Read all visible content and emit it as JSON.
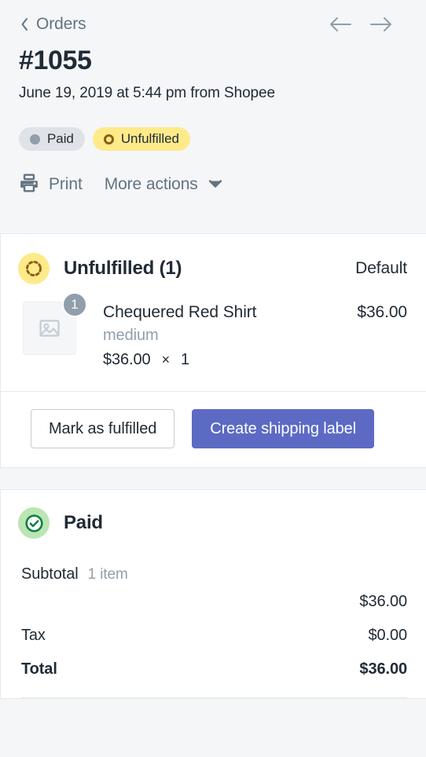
{
  "header": {
    "breadcrumb_label": "Orders",
    "breadcrumb_icon": "chevron-left-icon",
    "prev_icon": "arrow-left-icon",
    "next_icon": "arrow-right-icon",
    "order_number": "#1055",
    "order_meta": "June 19, 2019 at 5:44 pm from Shopee",
    "badges": [
      {
        "label": "Paid",
        "style": "paid",
        "icon": "filled-dot-icon",
        "bg": "#DFE3E8",
        "fg": "#212B36"
      },
      {
        "label": "Unfulfilled",
        "style": "unfulfilled",
        "icon": "hollow-ring-icon",
        "bg": "#FFEA8A",
        "fg": "#212B36"
      }
    ],
    "actions": {
      "print_label": "Print",
      "print_icon": "printer-icon",
      "more_label": "More actions",
      "more_icon": "caret-down-icon"
    }
  },
  "fulfillment": {
    "icon": "dashed-circle-icon",
    "icon_bg": "#FFEA8A",
    "title": "Unfulfilled (1)",
    "location": "Default",
    "items": [
      {
        "thumb_icon": "image-placeholder-icon",
        "quantity_badge": "1",
        "title": "Chequered Red Shirt",
        "variant": "medium",
        "unit_price": "$36.00",
        "times_symbol": "×",
        "quantity": "1",
        "line_total": "$36.00"
      }
    ],
    "buttons": {
      "secondary_label": "Mark as fulfilled",
      "primary_label": "Create shipping label",
      "primary_color": "#5C6AC4"
    }
  },
  "payment": {
    "icon": "check-circle-icon",
    "icon_bg": "#BBE5B3",
    "icon_fg": "#108043",
    "title": "Paid",
    "rows": [
      {
        "label": "Subtotal",
        "note": "1 item",
        "value": "$36.00",
        "wrapped": true,
        "bold": false
      },
      {
        "label": "Tax",
        "note": "",
        "value": "$0.00",
        "wrapped": false,
        "bold": false
      },
      {
        "label": "Total",
        "note": "",
        "value": "$36.00",
        "wrapped": false,
        "bold": true
      }
    ]
  }
}
